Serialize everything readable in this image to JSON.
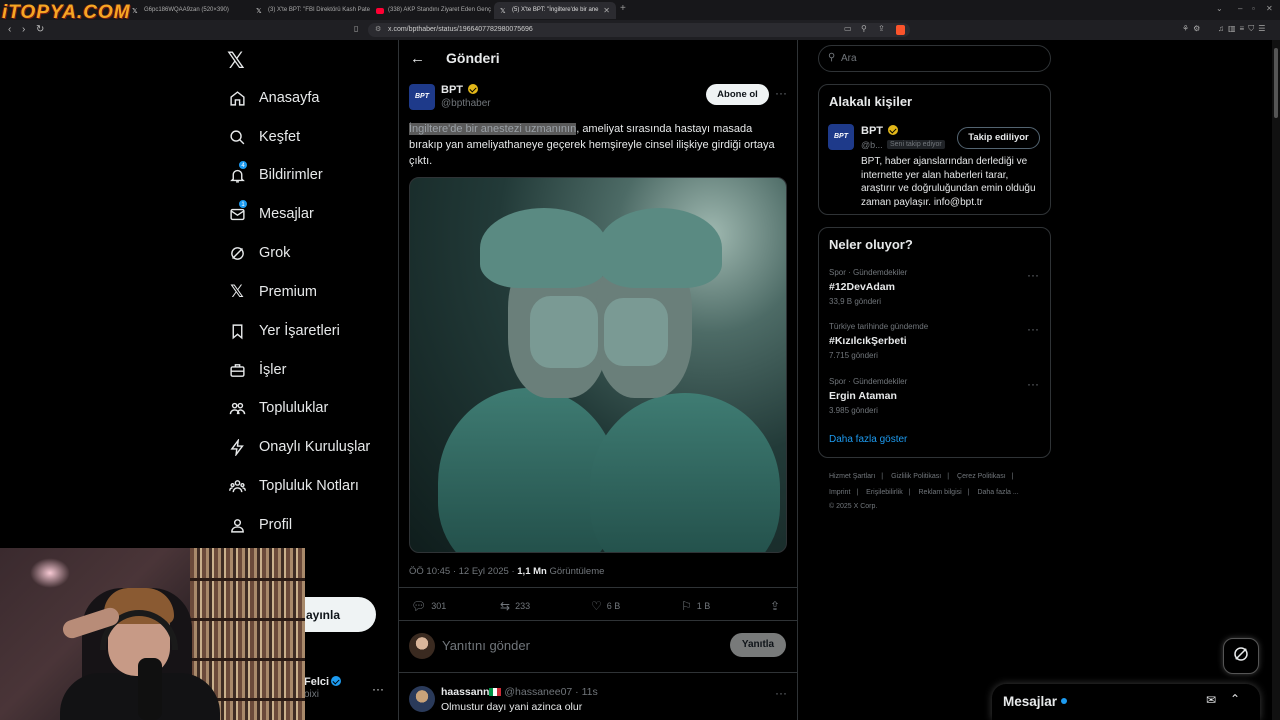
{
  "watermark": "iTOPYA.COM",
  "browser": {
    "tabs": [
      {
        "label": "G6pc186WQAA9zan (520×390)"
      },
      {
        "label": "(3) X'te BPT: \"FBI Direktörü Kash Pate"
      },
      {
        "label": "(338) AKP Standını Ziyaret Eden Genç"
      },
      {
        "label": "(5) X'te BPT: \"İngiltere'de bir ane"
      }
    ],
    "url": "x.com/bpthaber/status/1966407782980075696"
  },
  "sidebar": {
    "items": [
      {
        "label": "Anasayfa"
      },
      {
        "label": "Keşfet"
      },
      {
        "label": "Bildirimler",
        "badge": "4"
      },
      {
        "label": "Mesajlar",
        "badge": "1"
      },
      {
        "label": "Grok"
      },
      {
        "label": "Premium"
      },
      {
        "label": "Yer İşaretleri"
      },
      {
        "label": "İşler"
      },
      {
        "label": "Topluluklar"
      },
      {
        "label": "Onaylı Kuruluşlar"
      },
      {
        "label": "Topluluk Notları"
      },
      {
        "label": "Profil"
      },
      {
        "label": "zla"
      }
    ],
    "post_label": "ayınla",
    "account": {
      "name": "Felci",
      "handle": "oixi"
    }
  },
  "main": {
    "title": "Gönderi",
    "tweet": {
      "author": "BPT",
      "avatar_text": "BPT",
      "handle": "@bpthaber",
      "subscribe": "Abone ol",
      "text_highlight": "İngiltere'de bir anestezi uzmanının",
      "text_rest": ", ameliyat sırasında hastayı masada bırakıp yan ameliyathaneye geçerek hemşireyle cinsel ilişkiye girdiği ortaya çıktı.",
      "timestamp": "ÖÖ 10:45 · 12 Eyl 2025 · ",
      "views_count": "1,1 Mn",
      "views_label": " Görüntüleme",
      "replies": "301",
      "reposts": "233",
      "likes": "6 B",
      "bookmarks": "1 B"
    },
    "reply_placeholder": "Yanıtını gönder",
    "reply_button": "Yanıtla",
    "first_reply": {
      "name": "haassann",
      "handle": "@hassanee07 · 11s",
      "text": "Olmustur dayı yani azinca olur"
    }
  },
  "right": {
    "search_placeholder": "Ara",
    "relevant": {
      "title": "Alakalı kişiler",
      "name": "BPT",
      "handle": "@b...",
      "follows_you": "Seni takip ediyor",
      "button": "Takip ediliyor",
      "bio": "BPT, haber ajanslarından derlediği ve internette yer alan haberleri tarar, araştırır ve doğruluğundan emin olduğu zaman paylaşır. info@bpt.tr"
    },
    "trends": {
      "title": "Neler oluyor?",
      "items": [
        {
          "category": "Spor · Gündemdekiler",
          "title": "#12DevAdam",
          "count": "33,9 B gönderi"
        },
        {
          "category": "Türkiye tarihinde gündemde",
          "title": "#KızılcıkŞerbeti",
          "count": "7.715 gönderi"
        },
        {
          "category": "Spor · Gündemdekiler",
          "title": "Ergin Ataman",
          "count": "3.985 gönderi"
        }
      ],
      "show_more": "Daha fazla göster"
    },
    "footer": {
      "links": [
        "Hizmet Şartları",
        "Gizlilik Politikası",
        "Çerez Politikası",
        "Imprint",
        "Erişilebilirlik",
        "Reklam bilgisi",
        "Daha fazla ..."
      ],
      "copyright": "© 2025 X Corp."
    }
  },
  "messages_dock": {
    "title": "Mesajlar"
  },
  "colors": {
    "accent": "#1d9bf0",
    "background": "#000000",
    "border": "#2f3336",
    "muted": "#71767b"
  }
}
